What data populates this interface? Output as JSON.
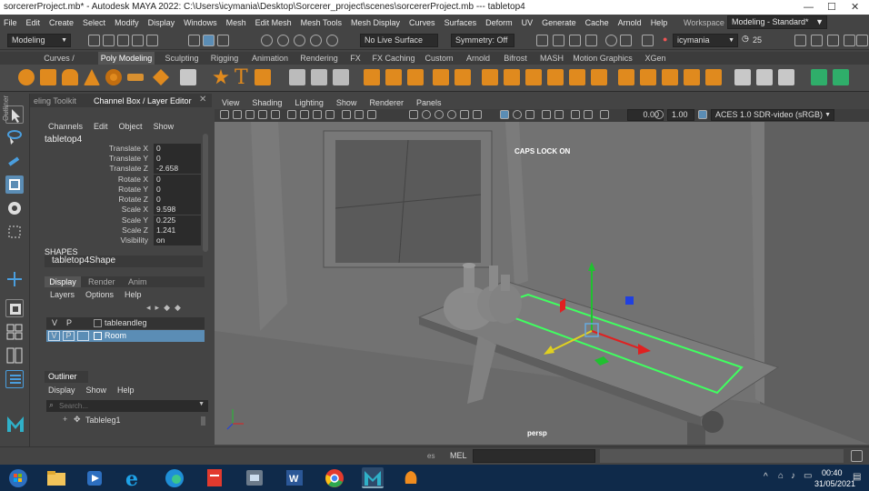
{
  "title_bar": {
    "text": "sorcererProject.mb* - Autodesk MAYA 2022: C:\\Users\\icymania\\Desktop\\Sorcerer_project\\scenes\\sorcererProject.mb   ---   tabletop4",
    "minimize": "—",
    "maximize": "☐",
    "close": "✕"
  },
  "menu": [
    "File",
    "Edit",
    "Create",
    "Select",
    "Modify",
    "Display",
    "Windows",
    "Mesh",
    "Edit Mesh",
    "Mesh Tools",
    "Mesh Display",
    "Curves",
    "Surfaces",
    "Deform",
    "UV",
    "Generate",
    "Cache",
    "Arnold",
    "Help"
  ],
  "workspace": {
    "label": "Workspace :",
    "value": "Modeling - Standard*"
  },
  "status": {
    "mode": "Modeling",
    "live_surface": "No Live Surface",
    "symmetry": "Symmetry: Off",
    "user": "icymania",
    "count": "25"
  },
  "shelf_tabs": [
    "Curves / Surfaces",
    "Poly Modeling",
    "Sculpting",
    "Rigging",
    "Animation",
    "Rendering",
    "FX",
    "FX Caching",
    "Custom",
    "Arnold",
    "Bifrost",
    "MASH",
    "Motion Graphics",
    "XGen"
  ],
  "shelf_active": "Poly Modeling",
  "left_tabs": [
    "eling Toolkit",
    "Channel Box / Layer Editor"
  ],
  "channel_menu": [
    "Channels",
    "Edit",
    "Object",
    "Show"
  ],
  "object_name": "tabletop4",
  "channels": [
    {
      "label": "Translate X",
      "value": "0"
    },
    {
      "label": "Translate Y",
      "value": "0"
    },
    {
      "label": "Translate Z",
      "value": "-2.658"
    },
    {
      "label": "Rotate X",
      "value": "0"
    },
    {
      "label": "Rotate Y",
      "value": "0"
    },
    {
      "label": "Rotate Z",
      "value": "0"
    },
    {
      "label": "Scale X",
      "value": "9.598"
    },
    {
      "label": "Scale Y",
      "value": "0.225"
    },
    {
      "label": "Scale Z",
      "value": "1.241"
    },
    {
      "label": "Visibility",
      "value": "on"
    }
  ],
  "shapes_label": "SHAPES",
  "shape_name": "tabletop4Shape",
  "layer_tabs": [
    "Display",
    "Render",
    "Anim"
  ],
  "layer_menu": [
    "Layers",
    "Options",
    "Help"
  ],
  "layers": [
    {
      "v": "V",
      "p": "P",
      "name": "tableandleg"
    },
    {
      "v": "V",
      "p": "P",
      "name": "Room"
    }
  ],
  "outliner": {
    "title": "Outliner",
    "menu": [
      "Display",
      "Show",
      "Help"
    ],
    "search_placeholder": "Search...",
    "item": "Tableleg1"
  },
  "outliner_side": "Outliner",
  "viewport_menu": [
    "View",
    "Shading",
    "Lighting",
    "Show",
    "Renderer",
    "Panels"
  ],
  "viewport_fields": {
    "exposure": "0.00",
    "gamma": "1.00",
    "colorspace": "ACES 1.0 SDR-video (sRGB)"
  },
  "hud": {
    "caps": "CAPS LOCK ON",
    "camera": "persp"
  },
  "cmd": {
    "label": "MEL"
  },
  "clock": {
    "time": "00:40",
    "date": "31/05/2021"
  },
  "colors": {
    "panel": "#444444",
    "viewport": "#6b6b6b",
    "accent": "#5b8db5",
    "manip_x": "#e02020",
    "manip_y": "#20c030",
    "manip_z": "#2040e0",
    "highlight": "#40ff60"
  }
}
